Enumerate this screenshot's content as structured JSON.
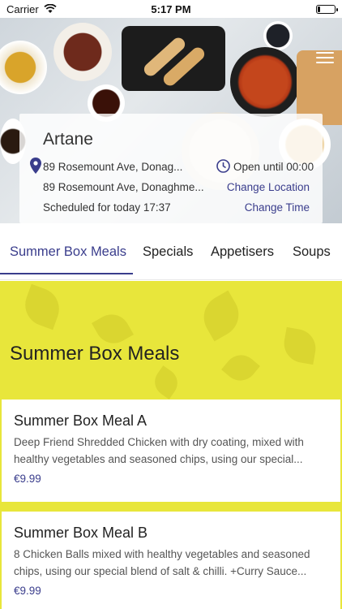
{
  "status_bar": {
    "carrier": "Carrier",
    "time": "5:17 PM",
    "battery_level": 0.15
  },
  "location_card": {
    "title": "Artane",
    "address_primary": "89 Rosemount Ave, Donag...",
    "address_secondary": "89 Rosemount Ave, Donaghme...",
    "open_hours": "Open until 00:00",
    "change_location_label": "Change Location",
    "schedule": "Scheduled for today 17:37",
    "change_time_label": "Change Time"
  },
  "tabs": [
    {
      "label": "Summer Box Meals",
      "active": true
    },
    {
      "label": "Specials",
      "active": false
    },
    {
      "label": "Appetisers",
      "active": false
    },
    {
      "label": "Soups",
      "active": false
    }
  ],
  "section": {
    "title": "Summer Box Meals"
  },
  "meals": [
    {
      "name": "Summer Box Meal A",
      "description": "Deep Friend Shredded Chicken with dry coating, mixed with healthy vegetables and seasoned chips, using our special...",
      "price": "€9.99"
    },
    {
      "name": "Summer Box Meal B",
      "description": "8 Chicken Balls mixed with healthy vegetables and seasoned chips, using our special blend of salt & chilli. +Curry Sauce...",
      "price": "€9.99"
    }
  ],
  "colors": {
    "accent": "#3a3d8c",
    "banner": "#e8e63b"
  },
  "icons": [
    "wifi-icon",
    "battery-icon",
    "menu-icon",
    "location-pin-icon",
    "clock-icon"
  ]
}
